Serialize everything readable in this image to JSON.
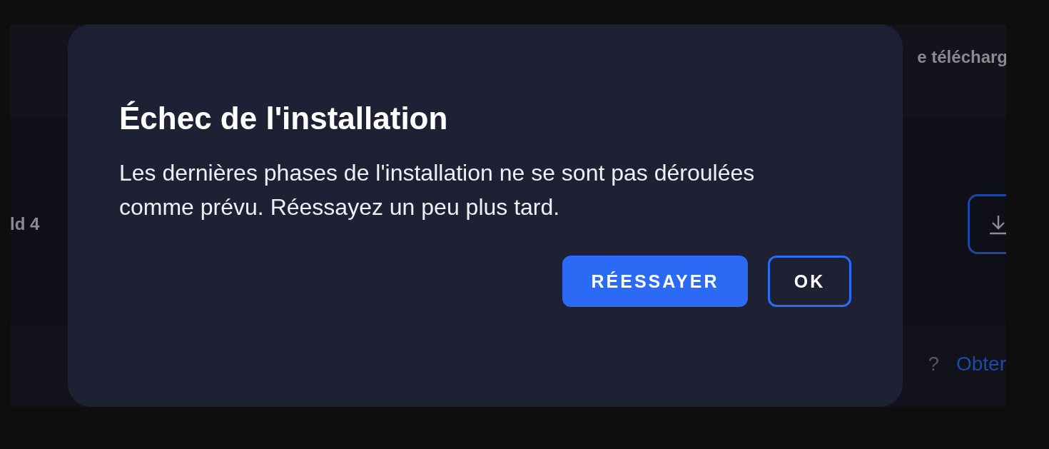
{
  "background": {
    "header_text": "e télécharg",
    "row_label": "ld 4",
    "footer_text": "?",
    "footer_link": "Obter"
  },
  "dialog": {
    "title": "Échec de l'installation",
    "message": "Les dernières phases de l'installation ne se sont pas déroulées comme prévu. Réessayez un peu plus tard.",
    "buttons": [
      {
        "label": "RÉESSAYER",
        "kind": "primary"
      },
      {
        "label": "OK",
        "kind": "outline"
      }
    ]
  }
}
